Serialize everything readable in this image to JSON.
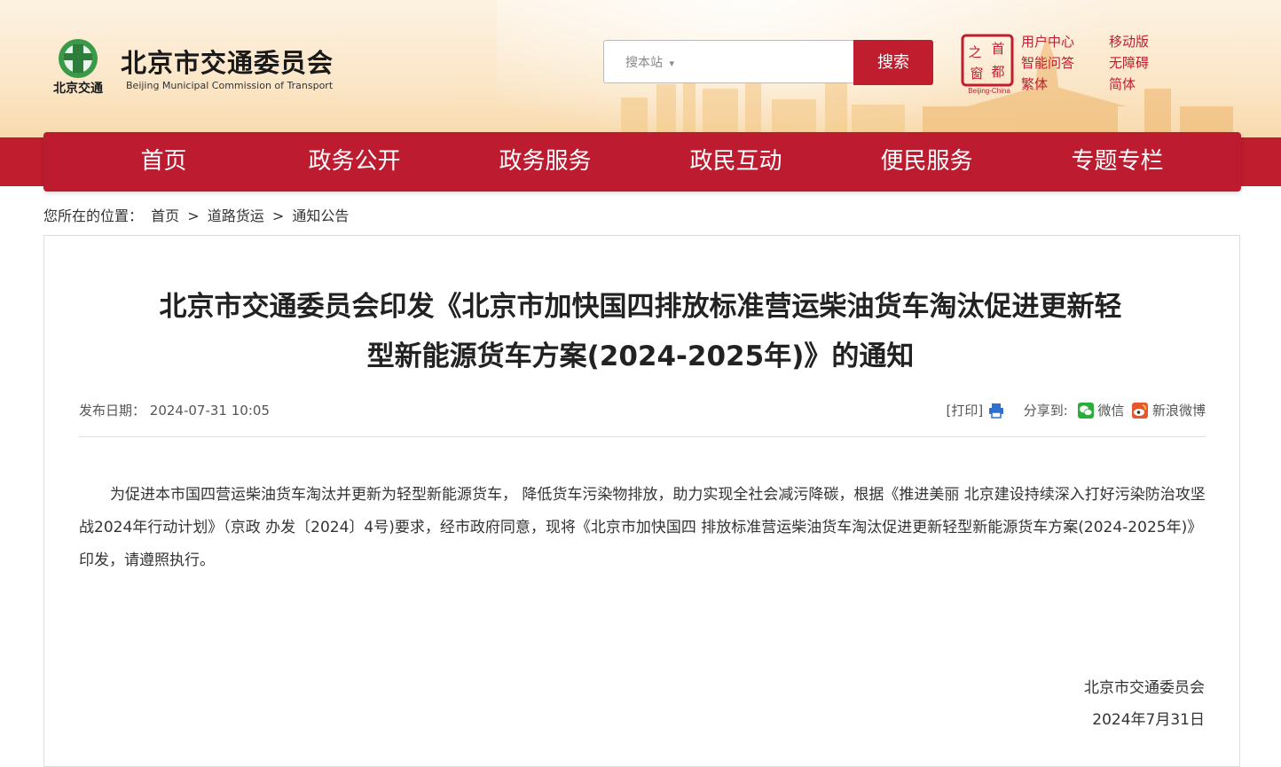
{
  "logo": {
    "cn": "北京市交通委员会",
    "en": "Beijing Municipal Commission of Transport",
    "emblem_text": "北京交通"
  },
  "search": {
    "placeholder": "搜本站",
    "dropdown_caret": "▾",
    "button": "搜索"
  },
  "seal": {
    "chars": [
      "之",
      "首",
      "窗",
      "都"
    ],
    "caption": "Beijing-China"
  },
  "top_links": [
    "用户中心",
    "移动版",
    "智能问答",
    "无障碍",
    "繁体",
    "简体"
  ],
  "nav": [
    "首页",
    "政务公开",
    "政务服务",
    "政民互动",
    "便民服务",
    "专题专栏"
  ],
  "breadcrumb": {
    "label": "您所在的位置：",
    "items": [
      "首页",
      "道路货运",
      "通知公告"
    ],
    "sep": ">"
  },
  "article": {
    "title_line1": "北京市交通委员会印发《北京市加快国四排放标准营运柴油货车淘汰促进更新轻",
    "title_line2": "型新能源货车方案(2024-2025年)》的通知",
    "date_label": "发布日期：",
    "date": "2024-07-31 10:05",
    "print": "[打印]",
    "share_label": "分享到:",
    "share_wechat": "微信",
    "share_weibo": "新浪微博",
    "body": "为促进本市国四营运柴油货车淘汰并更新为轻型新能源货车， 降低货车污染物排放，助力实现全社会减污降碳，根据《推进美丽 北京建设持续深入打好污染防治攻坚战2024年行动计划》（京政 办发〔2024〕4号)要求，经市政府同意，现将《北京市加快国四 排放标准营运柴油货车淘汰促进更新轻型新能源货车方案(2024-2025年)》印发，请遵照执行。",
    "sign_org": "北京市交通委员会",
    "sign_date": "2024年7月31日"
  },
  "colors": {
    "brand_red": "#c01d2e",
    "banner": "#fbe6c7"
  }
}
